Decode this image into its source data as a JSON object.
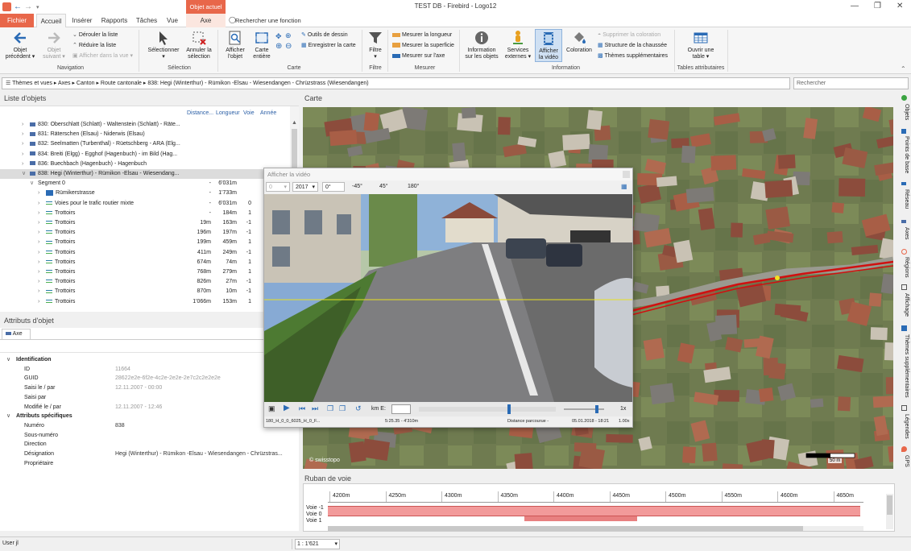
{
  "window": {
    "title": "TEST DB - Firebird - Logo12",
    "context_label": "Objet actuel"
  },
  "tabs": [
    "Fichier",
    "Accueil",
    "Insérer",
    "Rapports",
    "Tâches",
    "Vue",
    "Axe"
  ],
  "tell_me": "Rechercher une fonction",
  "ribbon": {
    "nav": {
      "prev": [
        "Objet",
        "précédent"
      ],
      "next": [
        "Objet",
        "suivant"
      ],
      "unroll": "Dérouler la liste",
      "reduce": "Réduire la liste",
      "show_view": "Afficher dans la vue",
      "group": "Navigation"
    },
    "selection": {
      "select": "Sélectionner",
      "cancel": [
        "Annuler la",
        "sélection"
      ],
      "group": "Sélection"
    },
    "carte": {
      "show_obj": [
        "Afficher",
        "l'objet"
      ],
      "full_map": [
        "Carte",
        "entière"
      ],
      "draw_tools": "Outils de dessin",
      "save_map": "Enregistrer la carte",
      "group": "Carte"
    },
    "filtre": {
      "filter": "Filtre",
      "group": "Filtre"
    },
    "mesurer": {
      "len": "Mesurer la longueur",
      "area": "Mesurer la superficie",
      "axis": "Mesurer sur l'axe",
      "group": "Mesurer"
    },
    "info": {
      "obj_info": [
        "Information",
        "sur les objets"
      ],
      "services": [
        "Services",
        "externes"
      ],
      "video": [
        "Afficher",
        "la vidéo"
      ],
      "color": "Coloration",
      "remove_color": "Supprimer la coloration",
      "struct": "Structure de la chaussée",
      "themes": "Thèmes supplémentaires",
      "group": "Information"
    },
    "tables": {
      "open": [
        "Ouvrir une",
        "table"
      ],
      "group": "Tables attributaires"
    }
  },
  "breadcrumb": [
    "Thèmes et vues",
    "Axes",
    "Canton",
    "Route cantonale",
    "838: Hegi (Winterthur) - Rümikon -Elsau - Wiesendangen - Chrüzstrass (Wiesendangen)"
  ],
  "search_placeholder": "Rechercher",
  "object_list": {
    "title": "Liste d'objets",
    "columns": [
      "Distance...",
      "Longueur",
      "Voie",
      "Année"
    ],
    "rows": [
      {
        "name": "830: Oberschlatt (Schlatt) - Waltenstein (Schlatt) - Räte...",
        "dist": "",
        "len": "",
        "voie": "",
        "icon": "sq",
        "ind": 0
      },
      {
        "name": "831: Räterschen (Elsau) - Niderwis (Elsau)",
        "dist": "",
        "len": "",
        "voie": "",
        "icon": "sq",
        "ind": 0
      },
      {
        "name": "832: Seelmatten (Turbenthal) - Rüetschberg - ARA (Elg...",
        "dist": "",
        "len": "",
        "voie": "",
        "icon": "sq",
        "ind": 0
      },
      {
        "name": "834: Breiti (Elgg) - Egghof (Hagenbuch) - im Bild (Hag...",
        "dist": "",
        "len": "",
        "voie": "",
        "icon": "sq",
        "ind": 0
      },
      {
        "name": "836: Buechbach (Hagenbuch) - Hagenbuch",
        "dist": "",
        "len": "",
        "voie": "",
        "icon": "sq",
        "ind": 0
      },
      {
        "name": "838: Hegi (Winterthur) - Rümikon -Elsau - Wiesendang...",
        "dist": "",
        "len": "",
        "voie": "",
        "icon": "sq",
        "ind": 0,
        "sel": true
      },
      {
        "name": "Segment 0",
        "dist": "-",
        "len": "6'031m",
        "voie": "",
        "icon": "none",
        "ind": 1
      },
      {
        "name": "Rümikerstrasse",
        "dist": "-",
        "len": "1'733m",
        "voie": "",
        "icon": "img",
        "ind": 2
      },
      {
        "name": "Voies pour le trafic routier mixte",
        "dist": "-",
        "len": "6'031m",
        "voie": "0",
        "icon": "ln",
        "ind": 2
      },
      {
        "name": "Trottoirs",
        "dist": "-",
        "len": "184m",
        "voie": "1",
        "icon": "ln",
        "ind": 2
      },
      {
        "name": "Trottoirs",
        "dist": "19m",
        "len": "163m",
        "voie": "-1",
        "icon": "ln",
        "ind": 2
      },
      {
        "name": "Trottoirs",
        "dist": "196m",
        "len": "197m",
        "voie": "-1",
        "icon": "ln",
        "ind": 2
      },
      {
        "name": "Trottoirs",
        "dist": "199m",
        "len": "459m",
        "voie": "1",
        "icon": "ln",
        "ind": 2
      },
      {
        "name": "Trottoirs",
        "dist": "411m",
        "len": "249m",
        "voie": "-1",
        "icon": "ln",
        "ind": 2
      },
      {
        "name": "Trottoirs",
        "dist": "674m",
        "len": "74m",
        "voie": "1",
        "icon": "ln",
        "ind": 2
      },
      {
        "name": "Trottoirs",
        "dist": "768m",
        "len": "279m",
        "voie": "1",
        "icon": "ln",
        "ind": 2
      },
      {
        "name": "Trottoirs",
        "dist": "826m",
        "len": "27m",
        "voie": "-1",
        "icon": "ln",
        "ind": 2
      },
      {
        "name": "Trottoirs",
        "dist": "870m",
        "len": "10m",
        "voie": "-1",
        "icon": "ln",
        "ind": 2
      },
      {
        "name": "Trottoirs",
        "dist": "1'066m",
        "len": "153m",
        "voie": "1",
        "icon": "ln",
        "ind": 2
      }
    ]
  },
  "attributes": {
    "title": "Attributs d'objet",
    "tab": "Axe",
    "rows": [
      {
        "k": "Identification",
        "v": "",
        "sec": true
      },
      {
        "k": "ID",
        "v": "11664",
        "gray": true
      },
      {
        "k": "GUID",
        "v": "28622e2e-6f2e-4c2e-2e2e-2e7c2c2e2e2e",
        "gray": true
      },
      {
        "k": "Saisi le / par",
        "v": "12.11.2007 - 00:00",
        "gray": true
      },
      {
        "k": "Saisi par",
        "v": ""
      },
      {
        "k": "Modifié le / par",
        "v": "12.11.2007 - 12:46",
        "gray": true
      },
      {
        "k": "Attributs spécifiques",
        "v": "",
        "sec": true
      },
      {
        "k": "Numéro",
        "v": "838"
      },
      {
        "k": "Sous-numéro",
        "v": ""
      },
      {
        "k": "Direction",
        "v": ""
      },
      {
        "k": "Désignation",
        "v": "Hegi (Winterthur) - Rümikon -Elsau - Wiesendangen - Chrüzstras..."
      },
      {
        "k": "Propriétaire",
        "v": ""
      }
    ]
  },
  "map": {
    "title": "Carte",
    "attribution": "© swisstopo",
    "scale": "50 m"
  },
  "video": {
    "title": "Afficher la vidéo",
    "year_left": "0",
    "year": "2017",
    "angle": "0°",
    "angles": [
      "-45°",
      "45°",
      "180°"
    ],
    "km_label": "km E:",
    "speed": "1x",
    "status": [
      "180_H_0_0_6025_H_0_F...",
      "5:25.35 - 4'310m",
      "Distance parcourue -",
      "05.01.2018 - 18:21",
      "1.00x"
    ]
  },
  "ruban": {
    "title": "Ruban de voie",
    "ticks": [
      "4200m",
      "4250m",
      "4300m",
      "4350m",
      "4400m",
      "4450m",
      "4500m",
      "4550m",
      "4600m",
      "4650m"
    ],
    "lanes": [
      "Voie -1",
      "Voie 0",
      "Voie 1"
    ]
  },
  "right_tabs": [
    "Objets",
    "Points de base",
    "Réseau",
    "Axes",
    "Régions",
    "Affichage",
    "Thèmes supplémentaires",
    "Légendes",
    "GPS"
  ],
  "status": {
    "user": "User jl",
    "scale": "1 : 1'621"
  },
  "colors": {
    "accent": "#e8674a",
    "brand_blue": "#1b5fa8",
    "road_highlight": "#d01010",
    "ruban_bar": "#f29a9a"
  }
}
